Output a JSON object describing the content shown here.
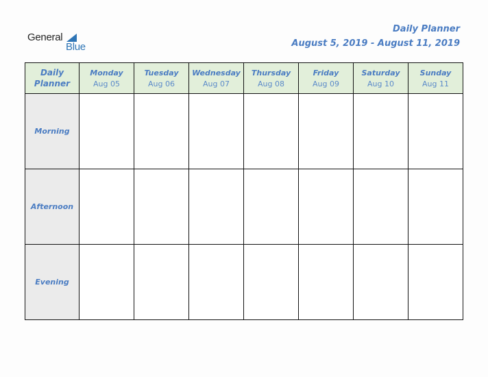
{
  "logo": {
    "word1": "General",
    "word2": "Blue",
    "icon": "blue-triangle-icon"
  },
  "header": {
    "title": "Daily Planner",
    "date_range": "August 5, 2019 - August 11, 2019"
  },
  "table": {
    "corner_label_line1": "Daily",
    "corner_label_line2": "Planner",
    "days": [
      {
        "name": "Monday",
        "date": "Aug 05"
      },
      {
        "name": "Tuesday",
        "date": "Aug 06"
      },
      {
        "name": "Wednesday",
        "date": "Aug 07"
      },
      {
        "name": "Thursday",
        "date": "Aug 08"
      },
      {
        "name": "Friday",
        "date": "Aug 09"
      },
      {
        "name": "Saturday",
        "date": "Aug 10"
      },
      {
        "name": "Sunday",
        "date": "Aug 11"
      }
    ],
    "rows": [
      {
        "label": "Morning"
      },
      {
        "label": "Afternoon"
      },
      {
        "label": "Evening"
      }
    ]
  },
  "colors": {
    "accent": "#4a7cc2",
    "header_bg": "#e2efda",
    "label_bg": "#ebebeb",
    "logo_blue": "#2e75b6"
  }
}
